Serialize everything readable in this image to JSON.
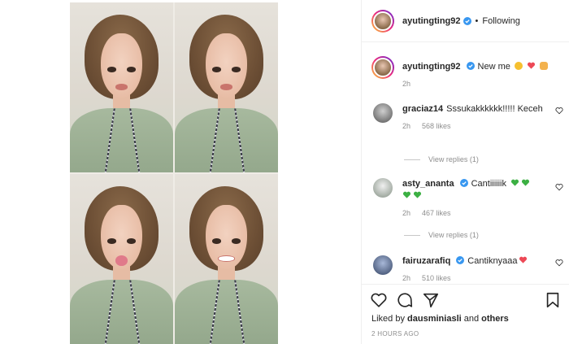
{
  "post": {
    "author": "ayutingting92",
    "follow_state": "Following",
    "separator": "•",
    "caption": "New me",
    "caption_time": "2h"
  },
  "comments": [
    {
      "username": "graciaz14",
      "text": "Sssukakkkkkk!!!!! Keceh",
      "time": "2h",
      "likes": "568 likes",
      "replies": "View replies (1)"
    },
    {
      "username": "asty_ananta",
      "text": "Cantiiiiiik",
      "time": "2h",
      "likes": "467 likes",
      "replies": "View replies (1)"
    },
    {
      "username": "fairuzarafiq",
      "text": "Cantiknyaaa",
      "time": "2h",
      "likes": "510 likes"
    }
  ],
  "footer": {
    "liked_by_prefix": "Liked by",
    "liked_by_user": "dausminiasli",
    "liked_by_and": "and",
    "liked_by_others": "others",
    "post_time": "2 HOURS AGO"
  },
  "icons": {
    "like": "heart-icon",
    "comment": "comment-icon",
    "share": "share-icon",
    "save": "bookmark-icon",
    "verified": "verified-badge-icon"
  },
  "colors": {
    "verified": "#3897f0",
    "heart_red": "#ed4956",
    "green_heart": "#3cb043",
    "muted_text": "#8e8e8e"
  }
}
